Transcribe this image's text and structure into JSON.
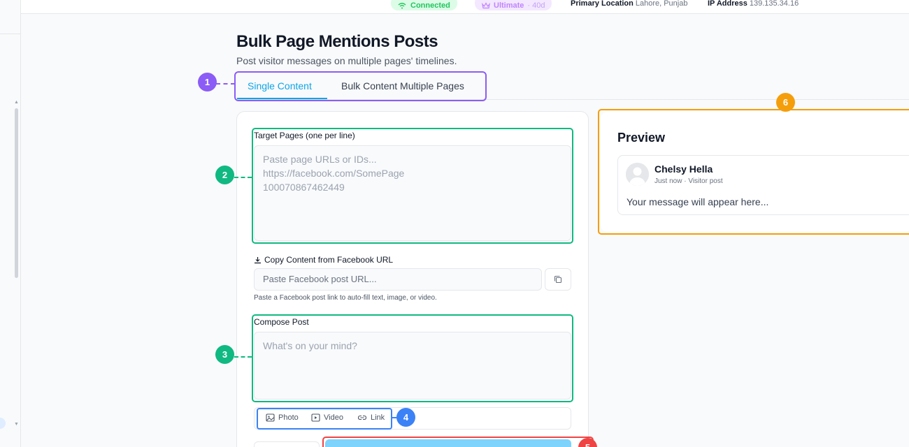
{
  "topbar": {
    "connected_label": "Connected",
    "plan_label": "Ultimate",
    "plan_days": "· 40d",
    "location_label": "Primary Location",
    "location_value": "Lahore, Punjab",
    "ip_label": "IP Address",
    "ip_value": "139.135.34.16"
  },
  "header": {
    "title": "Bulk Page Mentions Posts",
    "subtitle": "Post visitor messages on multiple pages' timelines."
  },
  "tabs": [
    {
      "label": "Single Content",
      "active": true
    },
    {
      "label": "Bulk Content Multiple Pages",
      "active": false
    }
  ],
  "markers": [
    "1",
    "2",
    "3",
    "4",
    "5",
    "6"
  ],
  "form": {
    "target_label": "Target Pages (one per line)",
    "target_placeholder": "Paste page URLs or IDs...\nhttps://facebook.com/SomePage\n100070867462449",
    "copy_label": "Copy Content from Facebook URL",
    "copy_placeholder": "Paste Facebook post URL...",
    "copy_help": "Paste a Facebook post link to auto-fill text, image, or video.",
    "compose_label": "Compose Post",
    "compose_placeholder": "What's on your mind?",
    "media": {
      "photo": "Photo",
      "video": "Video",
      "link": "Link"
    }
  },
  "preview": {
    "title": "Preview",
    "author": "Chelsy Hella",
    "meta": "Just now · Visitor post",
    "body": "Your message will appear here..."
  },
  "colors": {
    "marker_1": "#8b5cf6",
    "marker_2": "#10b981",
    "marker_3": "#10b981",
    "marker_4": "#3b82f6",
    "marker_5": "#ef4444",
    "marker_6": "#f59e0b",
    "accent": "#0ea5e9"
  }
}
